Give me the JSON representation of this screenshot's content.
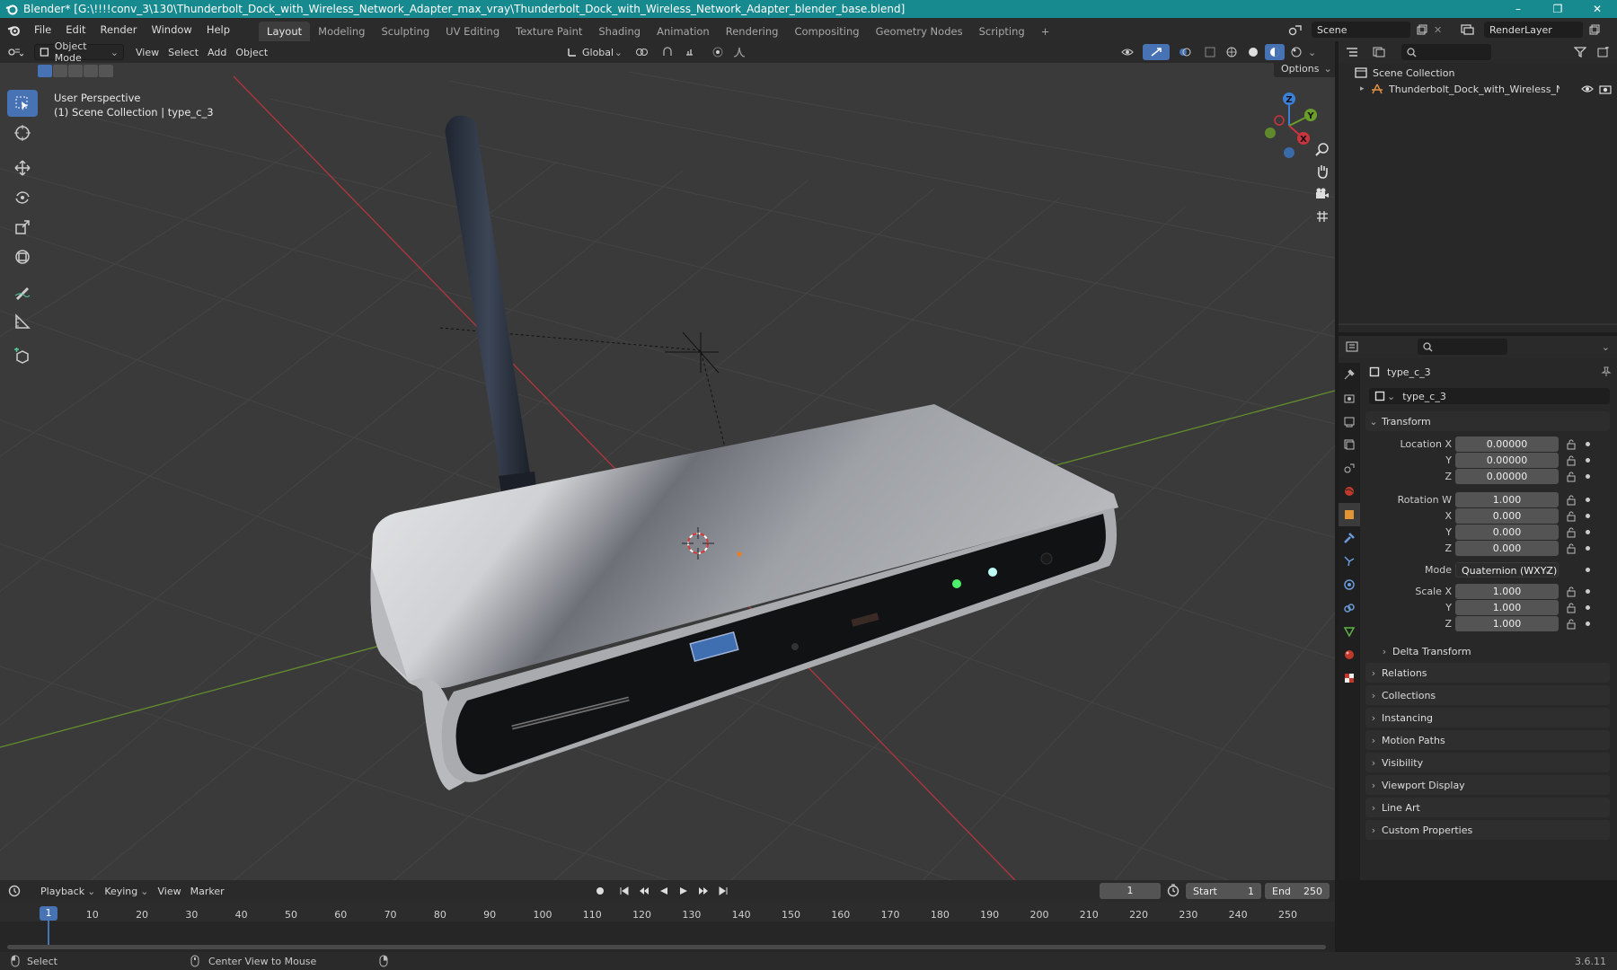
{
  "window": {
    "title": "Blender* [G:\\!!!!conv_3\\130\\Thunderbolt_Dock_with_Wireless_Network_Adapter_max_vray\\Thunderbolt_Dock_with_Wireless_Network_Adapter_blender_base.blend]",
    "controls": [
      "–",
      "❐",
      "✕"
    ]
  },
  "menubar": {
    "menus": [
      "File",
      "Edit",
      "Render",
      "Window",
      "Help"
    ],
    "workspaces": [
      "Layout",
      "Modeling",
      "Sculpting",
      "UV Editing",
      "Texture Paint",
      "Shading",
      "Animation",
      "Rendering",
      "Compositing",
      "Geometry Nodes",
      "Scripting"
    ],
    "active_workspace": "Layout",
    "add_tab": "+",
    "scene": "Scene",
    "render_layer": "RenderLayer"
  },
  "viewport_header": {
    "mode": "Object Mode",
    "menus": [
      "View",
      "Select",
      "Add",
      "Object"
    ],
    "orientation": "Global",
    "options": "Options"
  },
  "viewport": {
    "perspective": "User Perspective",
    "collection_info": "(1) Scene Collection | type_c_3",
    "gizmo": {
      "z": "Z",
      "y": "Y",
      "x": "X"
    }
  },
  "outliner": {
    "root": "Scene Collection",
    "items": [
      {
        "name": "Thunderbolt_Dock_with_Wireless_Netw"
      }
    ]
  },
  "properties": {
    "object_name": "type_c_3",
    "data_name": "type_c_3",
    "transform": {
      "header": "Transform",
      "location_label": "Location X",
      "location": [
        "0.00000",
        "0.00000",
        "0.00000"
      ],
      "rotation_label": "Rotation W",
      "rotation": [
        "1.000",
        "0.000",
        "0.000",
        "0.000"
      ],
      "mode_label": "Mode",
      "mode": "Quaternion (WXYZ)",
      "scale_label": "Scale X",
      "scale": [
        "1.000",
        "1.000",
        "1.000"
      ],
      "y_label": "Y",
      "z_label": "Z",
      "x_label": "X",
      "delta": "Delta Transform"
    },
    "panels": [
      "Relations",
      "Collections",
      "Instancing",
      "Motion Paths",
      "Visibility",
      "Viewport Display",
      "Line Art",
      "Custom Properties"
    ]
  },
  "timeline": {
    "menus": [
      "Playback",
      "Keying",
      "View",
      "Marker"
    ],
    "current_frame": "1",
    "start_label": "Start",
    "start": "1",
    "end_label": "End",
    "end": "250",
    "ruler": [
      "1",
      "10",
      "20",
      "30",
      "40",
      "50",
      "60",
      "70",
      "80",
      "90",
      "100",
      "110",
      "120",
      "130",
      "140",
      "150",
      "160",
      "170",
      "180",
      "190",
      "200",
      "210",
      "220",
      "230",
      "240",
      "250"
    ]
  },
  "statusbar": {
    "select": "Select",
    "center_view": "Center View to Mouse",
    "version": "3.6.11"
  },
  "colors": {
    "title_bar": "#168a8f",
    "active_tool": "#4772b3",
    "axis_x": "#c8353f",
    "axis_y": "#6a9e2a",
    "axis_z": "#3b7fd6"
  }
}
